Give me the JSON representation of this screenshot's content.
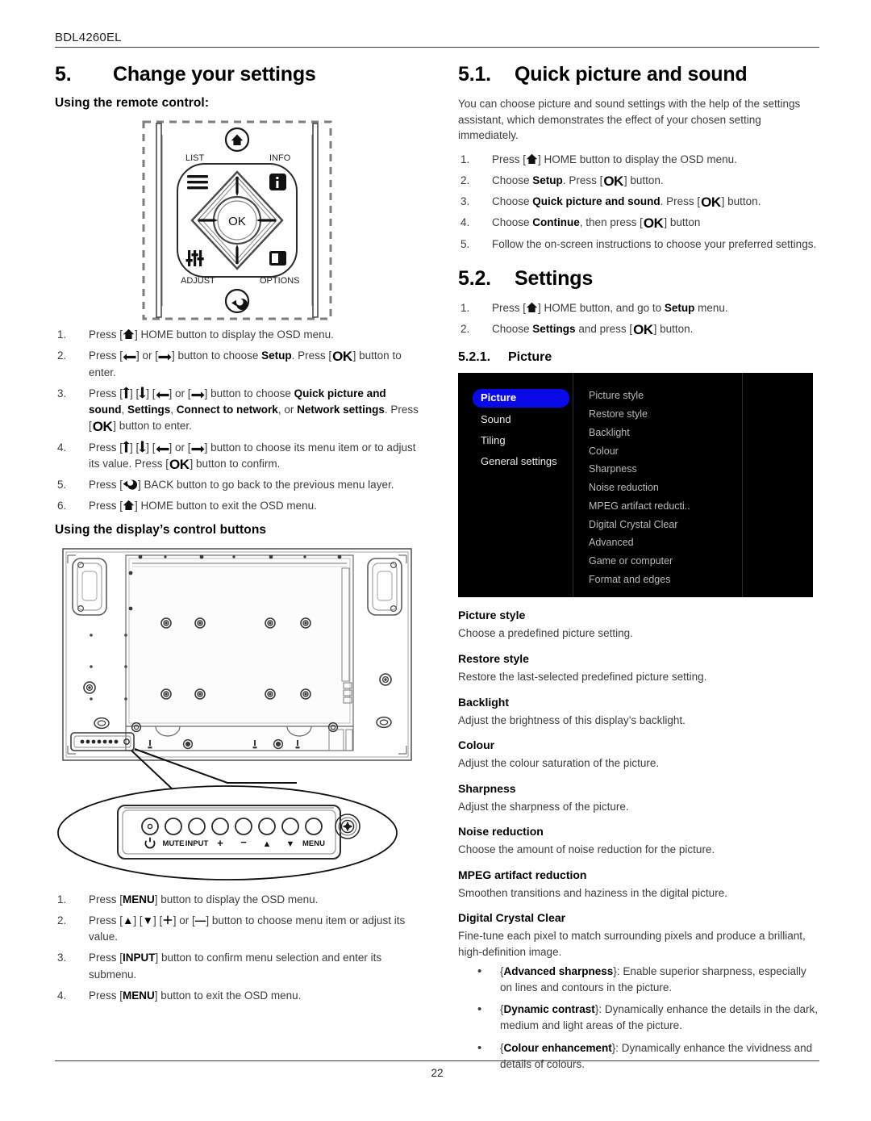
{
  "header": {
    "model": "BDL4260EL"
  },
  "footer": {
    "page_number": "22"
  },
  "left": {
    "section": {
      "number": "5.",
      "title": "Change your settings"
    },
    "remote_heading": "Using the remote control:",
    "remote_labels": {
      "list": "LIST",
      "info": "INFO",
      "adjust": "ADJUST",
      "options": "OPTIONS",
      "ok": "OK"
    },
    "remote_steps": [
      {
        "idx": "1.",
        "html": "Press [<span class='key' data-name='home-icon-inline'>{HOME}</span>] HOME button to display the OSD menu."
      },
      {
        "idx": "2.",
        "html": "Press [<span class='key'>{LEFT}</span>] or [<span class='key'>{RIGHT}</span>] button to choose <b>Setup</b>. Press [<span class='ok'>OK</span>] button to enter."
      },
      {
        "idx": "3.",
        "html": "Press [<span class='key'>{UP}</span>] [<span class='key'>{DOWN}</span>] [<span class='key'>{LEFT}</span>] or [<span class='key'>{RIGHT}</span>] button to choose <b>Quick picture and sound</b>, <b>Settings</b>, <b>Connect to network</b>, or <b>Network settings</b>. Press [<span class='ok'>OK</span>] button to enter."
      },
      {
        "idx": "4.",
        "html": "Press [<span class='key'>{UP}</span>] [<span class='key'>{DOWN}</span>] [<span class='key'>{LEFT}</span>] or [<span class='key'>{RIGHT}</span>] button to choose its menu item or to adjust its value. Press [<span class='ok'>OK</span>] button to confirm."
      },
      {
        "idx": "5.",
        "html": "Press [<span class='key'>{BACK}</span>] BACK button to go back to the previous menu layer."
      },
      {
        "idx": "6.",
        "html": "Press [<span class='key'>{HOME}</span>] HOME button to exit the OSD menu."
      }
    ],
    "controls_heading": "Using the display’s control buttons",
    "control_button_labels": [
      "MUTE",
      "INPUT",
      "+",
      "−",
      "▲",
      "▼",
      "MENU"
    ],
    "control_steps": [
      {
        "idx": "1.",
        "html": "Press [<span class='kb'>MENU</span>] button to display the OSD menu."
      },
      {
        "idx": "2.",
        "html": "Press [<span class='kb'>▲</span>] [<span class='kb'>▼</span>] [<span class='kb'>＋</span>] or [<span class='kb'>—</span>] button to choose menu item or adjust its value."
      },
      {
        "idx": "3.",
        "html": "Press [<span class='kb'>INPUT</span>] button to confirm menu selection and enter its submenu."
      },
      {
        "idx": "4.",
        "html": "Press [<span class='kb'>MENU</span>] button to exit the OSD menu."
      }
    ]
  },
  "right": {
    "quick": {
      "number": "5.1.",
      "title": "Quick picture and sound",
      "intro": "You can choose picture and sound settings with the help of the settings assistant, which demonstrates the effect of your chosen setting immediately.",
      "steps": [
        {
          "idx": "1.",
          "html": "Press [<span class='key'>{HOME}</span>] HOME button to display the OSD menu."
        },
        {
          "idx": "2.",
          "html": "Choose <b>Setup</b>. Press [<span class='ok'>OK</span>] button."
        },
        {
          "idx": "3.",
          "html": "Choose <b>Quick picture and sound</b>. Press [<span class='ok'>OK</span>] button."
        },
        {
          "idx": "4.",
          "html": "Choose <b>Continue</b>, then press [<span class='ok'>OK</span>] button"
        },
        {
          "idx": "5.",
          "html": "Follow the on-screen instructions to choose your preferred settings."
        }
      ]
    },
    "settings": {
      "number": "5.2.",
      "title": "Settings",
      "steps": [
        {
          "idx": "1.",
          "html": "Press [<span class='key'>{HOME}</span>] HOME button, and go to <b>Setup</b> menu."
        },
        {
          "idx": "2.",
          "html": "Choose <b>Settings</b> and press [<span class='ok'>OK</span>] button."
        }
      ]
    },
    "picture": {
      "number": "5.2.1.",
      "title": "Picture",
      "osd": {
        "menu_items": [
          "Picture",
          "Sound",
          "Tiling",
          "General settings"
        ],
        "selected_index": 0,
        "highlight_color": "#0a0ae8",
        "background_color": "#000000",
        "submenu_items": [
          "Picture style",
          "Restore style",
          "Backlight",
          "Colour",
          "Sharpness",
          "Noise reduction",
          "MPEG artifact reducti..",
          "Digital Crystal Clear",
          "Advanced",
          "Game or computer",
          "Format and edges"
        ]
      },
      "definitions": [
        {
          "term": "Picture style",
          "desc": "Choose a predefined picture setting."
        },
        {
          "term": "Restore style",
          "desc": "Restore the last-selected predefined picture setting."
        },
        {
          "term": "Backlight",
          "desc": "Adjust the brightness of this display’s backlight."
        },
        {
          "term": "Colour",
          "desc": "Adjust the colour saturation of the picture."
        },
        {
          "term": "Sharpness",
          "desc": "Adjust the sharpness of the picture."
        },
        {
          "term": "Noise reduction",
          "desc": "Choose the amount of noise reduction for the picture."
        },
        {
          "term": "MPEG artifact reduction",
          "desc": "Smoothen transitions and haziness in the digital picture."
        },
        {
          "term": "Digital Crystal Clear",
          "desc": "Fine-tune each pixel to match surrounding pixels and produce a brilliant, high-definition image."
        }
      ],
      "bullets": [
        {
          "html": "{<b>Advanced sharpness</b>}: Enable superior sharpness, especially on lines and contours in the picture."
        },
        {
          "html": "{<b>Dynamic contrast</b>}: Dynamically enhance the details in the dark, medium and light areas of the picture."
        },
        {
          "html": "{<b>Colour enhancement</b>}: Dynamically enhance the vividness and details of colours."
        }
      ]
    }
  }
}
